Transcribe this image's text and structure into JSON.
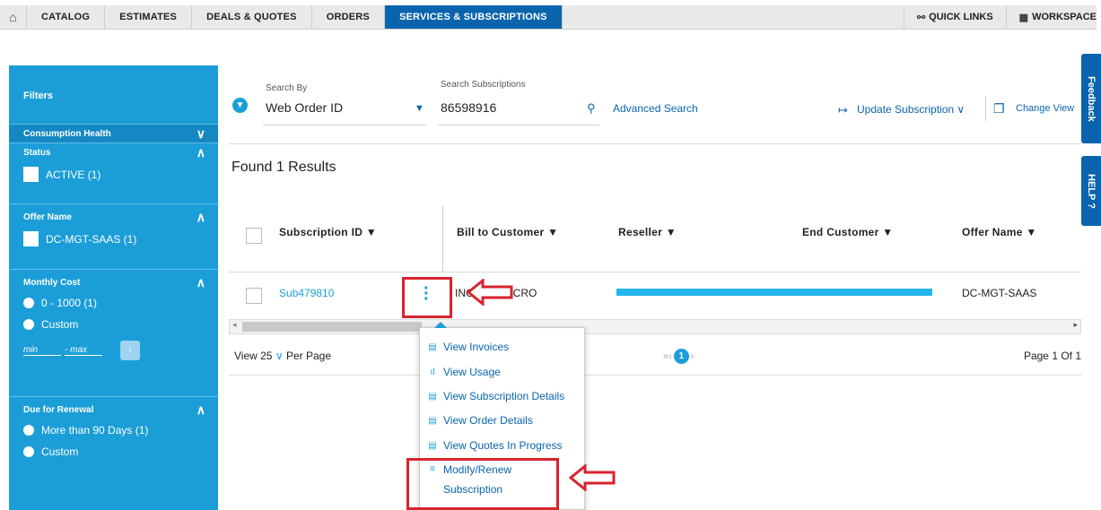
{
  "nav": {
    "home_icon": "home-icon",
    "tabs": [
      {
        "label": "CATALOG"
      },
      {
        "label": "ESTIMATES"
      },
      {
        "label": "DEALS & QUOTES"
      },
      {
        "label": "ORDERS"
      },
      {
        "label": "SERVICES & SUBSCRIPTIONS",
        "active": true
      }
    ],
    "quick_links": "QUICK LINKS",
    "workspace": "WORKSPACE"
  },
  "filters": {
    "title": "Filters",
    "sections": {
      "consumption": "Consumption Health",
      "status": "Status",
      "status_opt": "ACTIVE (1)",
      "offer": "Offer Name",
      "offer_opt": "DC-MGT-SAAS (1)",
      "cost": "Monthly Cost",
      "cost_opt1": "0 - 1000 (1)",
      "cost_opt2": "Custom",
      "min": "min",
      "max": "- max",
      "renewal": "Due for Renewal",
      "renewal_opt1": "More than 90 Days (1)",
      "renewal_opt2": "Custom"
    }
  },
  "search": {
    "by_label": "Search By",
    "by_value": "Web Order ID",
    "subs_label": "Search Subscriptions",
    "subs_value": "86598916",
    "advanced": "Advanced Search",
    "update": "Update Subscription",
    "change_view": "Change View"
  },
  "results": {
    "found": "Found 1 Results",
    "columns": {
      "sub_id": "Subscription ID ▼",
      "bill_to": "Bill to Customer ▼",
      "reseller": "Reseller ▼",
      "end_customer": "End Customer ▼",
      "offer": "Offer Name ▼"
    },
    "row": {
      "sub_id": "Sub479810",
      "bill_to": "INGRAM MICRO",
      "offer": "DC-MGT-SAAS"
    }
  },
  "pager": {
    "view": "View 25",
    "per_page": "Per Page",
    "current": "1",
    "page_info": "Page 1 Of 1"
  },
  "menu": {
    "items": [
      "View Invoices",
      "View Usage",
      "View Subscription Details",
      "View Order Details",
      "View Quotes In Progress",
      "Modify/Renew",
      "Subscription"
    ]
  },
  "side_tabs": {
    "feedback": "Feedback",
    "help": "HELP ?"
  },
  "colors": {
    "primary": "#0a64ad",
    "sidebar": "#1b9ed8",
    "highlight": "#d9232e"
  }
}
